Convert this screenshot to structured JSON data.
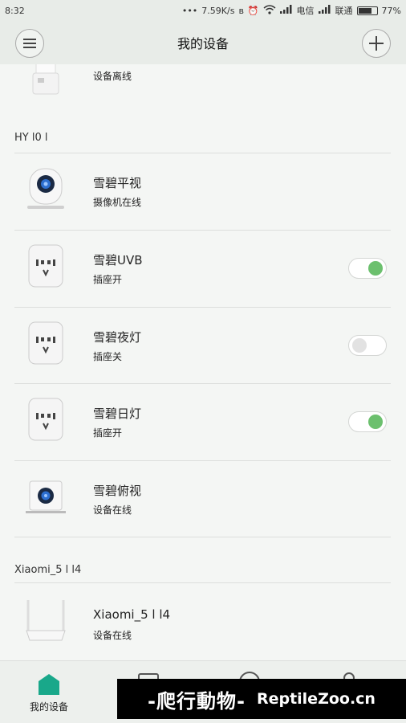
{
  "statusbar": {
    "time": "8:32",
    "net_speed": "7.59K/s",
    "carrier1": "电信",
    "carrier2": "联通",
    "battery": "77%",
    "battery_level": 0.77
  },
  "header": {
    "title": "我的设备"
  },
  "groups": [
    {
      "label": "HY l0 l",
      "devices": [
        {
          "name": "雪碧平视",
          "status": "摄像机在线",
          "icon": "camera-round-icon"
        },
        {
          "name": "雪碧UVB",
          "status": "插座开",
          "icon": "smart-plug-icon",
          "switch_on": true
        },
        {
          "name": "雪碧夜灯",
          "status": "插座关",
          "icon": "smart-plug-icon",
          "switch_on": false
        },
        {
          "name": "雪碧日灯",
          "status": "插座开",
          "icon": "smart-plug-icon",
          "switch_on": true
        },
        {
          "name": "雪碧俯视",
          "status": "设备在线",
          "icon": "camera-square-icon"
        }
      ]
    },
    {
      "label": "Xiaomi_5 l l4",
      "devices": [
        {
          "name": "Xiaomi_5 l l4",
          "status": "设备在线",
          "icon": "router-icon"
        }
      ]
    }
  ],
  "partial_top_device": {
    "status": "设备离线",
    "icon": "plug-device-icon"
  },
  "bottom_nav": {
    "my_devices": "我的设备"
  },
  "watermark": {
    "cn": "-爬行動物-",
    "en": "ReptileZoo.cn"
  },
  "colors": {
    "accent": "#19a88a",
    "switch_on": "#6cc06e",
    "background": "#f4f6f4"
  }
}
